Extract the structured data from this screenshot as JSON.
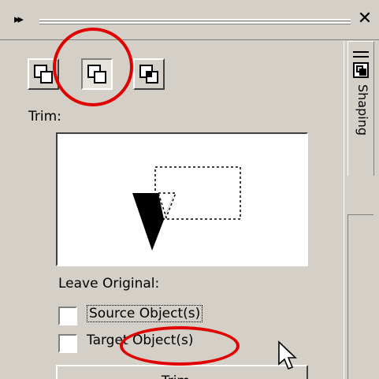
{
  "window": {
    "collapse_glyph": "▸▸",
    "close_glyph": "✕"
  },
  "docker_tab": {
    "label": "Shaping",
    "icon": "shaping-icon"
  },
  "shaping_modes": [
    {
      "name": "weld",
      "icon": "weld-icon",
      "pressed": false
    },
    {
      "name": "trim",
      "icon": "trim-icon",
      "pressed": true
    },
    {
      "name": "intersect",
      "icon": "intersect-icon",
      "pressed": false
    }
  ],
  "panel": {
    "mode_label": "Trim:",
    "leave_original_label": "Leave Original:",
    "source_checkbox": {
      "label": "Source Object(s)",
      "checked": false
    },
    "target_checkbox": {
      "label": "Target Object(s)",
      "checked": false
    },
    "apply_button_label": "Trim..."
  },
  "annotations": {
    "color": "#e00000"
  },
  "colors": {
    "face": "#d4d0c8",
    "highlight": "#ffffff",
    "shadow": "#808080"
  }
}
